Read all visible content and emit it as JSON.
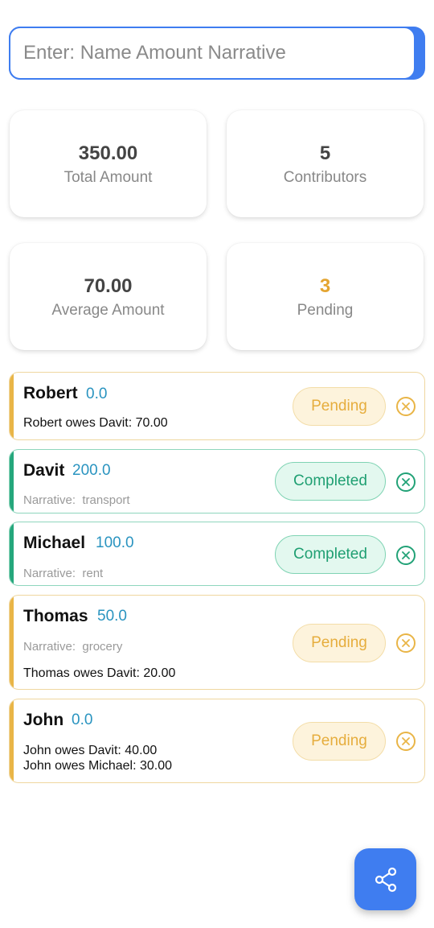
{
  "entry": {
    "placeholder": "Enter: Name Amount Narrative",
    "value": ""
  },
  "stats": {
    "total": {
      "value": "350.00",
      "label": "Total Amount"
    },
    "contributors": {
      "value": "5",
      "label": "Contributors"
    },
    "average": {
      "value": "70.00",
      "label": "Average Amount"
    },
    "pending": {
      "value": "3",
      "label": "Pending"
    }
  },
  "colors": {
    "accent": "#3f7df0",
    "pending": "#e9b547",
    "completed": "#25a77c",
    "amount": "#2a94c0"
  },
  "entries": [
    {
      "name": "Robert",
      "amount": "0.0",
      "status": "Pending",
      "owes": [
        "Robert owes Davit: 70.00"
      ]
    },
    {
      "name": "Davit",
      "amount": "200.0",
      "status": "Completed",
      "narrative_label": "Narrative:",
      "narrative": "transport"
    },
    {
      "name": "Michael",
      "amount": "100.0",
      "status": "Completed",
      "narrative_label": "Narrative:",
      "narrative": "rent"
    },
    {
      "name": "Thomas",
      "amount": "50.0",
      "status": "Pending",
      "narrative_label": "Narrative:",
      "narrative": "grocery",
      "owes": [
        "Thomas owes Davit: 20.00"
      ]
    },
    {
      "name": "John",
      "amount": "0.0",
      "status": "Pending",
      "owes": [
        "John owes Davit: 40.00",
        "John owes Michael: 30.00"
      ]
    }
  ],
  "icons": {
    "remove": "close-circle-icon",
    "fab": "share-icon"
  }
}
